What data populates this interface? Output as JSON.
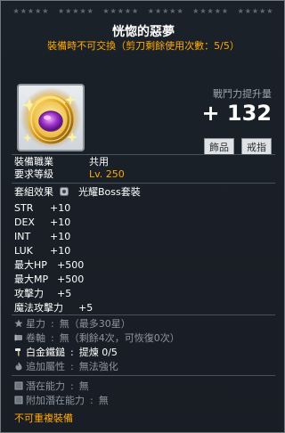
{
  "header": {
    "stars": [
      "★★★★★",
      "★★★★★",
      "★★★★★",
      "★★★★★",
      "★★★★★",
      "★★★★★"
    ],
    "item_name": "恍惚的惡夢",
    "trade_notice": "裝備時不可交換（剪刀剩餘使用次數：5/5）"
  },
  "item": {
    "icon_name": "ring-icon",
    "power_label": "戰鬥力提升量",
    "power_value": "+ 132",
    "tags": [
      "飾品",
      "戒指"
    ]
  },
  "requirements": [
    {
      "label": "裝備職業",
      "value": "共用"
    },
    {
      "label": "要求等級",
      "value": "Lv. 250"
    }
  ],
  "set_effect": {
    "label": "套組效果",
    "value": "光耀Boss套裝"
  },
  "stats": [
    {
      "label": "STR",
      "value": "+10"
    },
    {
      "label": "DEX",
      "value": "+10"
    },
    {
      "label": "INT",
      "value": "+10"
    },
    {
      "label": "LUK",
      "value": "+10"
    },
    {
      "label": "最大HP",
      "value": "+500"
    },
    {
      "label": "最大MP",
      "value": "+500"
    },
    {
      "label": "攻擊力",
      "value": "+5"
    },
    {
      "label": "魔法攻擊力",
      "value": "+5"
    }
  ],
  "enhance": [
    {
      "icon": "star-icon",
      "label": "星力",
      "value": "無（最多30星）",
      "highlight": false
    },
    {
      "icon": "scroll-icon",
      "label": "卷軸",
      "value": "無（剩餘4次，可恢復0次）",
      "highlight": false
    },
    {
      "icon": "hammer-icon",
      "label": "白金鐵鎚",
      "value": "提煉 0/5",
      "highlight": true
    },
    {
      "icon": "flame-icon",
      "label": "追加屬性",
      "value": "無法強化",
      "highlight": false
    }
  ],
  "potential": [
    {
      "icon": "square-icon",
      "label": "潛在能力",
      "value": "無"
    },
    {
      "icon": "square-icon",
      "label": "附加潛在能力",
      "value": "無"
    }
  ],
  "footer_note": "不可重複裝備",
  "colors": {
    "orange": "#ffaa00",
    "level": "#ffaa00",
    "dim": "#8c959d"
  }
}
